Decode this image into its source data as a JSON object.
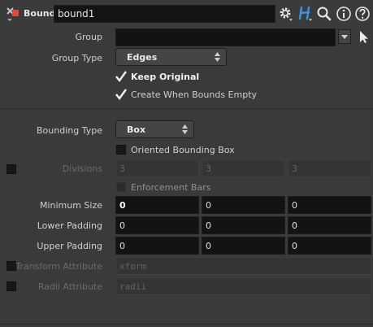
{
  "header": {
    "node_type": "Bound",
    "node_name": "bound1"
  },
  "group": {
    "label": "Group",
    "value": ""
  },
  "group_type": {
    "label": "Group Type",
    "value": "Edges"
  },
  "keep_original": {
    "label": "Keep Original",
    "checked": true
  },
  "create_when_empty": {
    "label": "Create When Bounds Empty",
    "checked": true
  },
  "bounding_type": {
    "label": "Bounding Type",
    "value": "Box"
  },
  "oriented_bbox": {
    "label": "Oriented Bounding Box",
    "checked": false
  },
  "divisions": {
    "label": "Divisions",
    "values": [
      "3",
      "3",
      "3"
    ]
  },
  "enforcement_bars": {
    "label": "Enforcement Bars",
    "checked": false
  },
  "minimum_size": {
    "label": "Minimum Size",
    "values": [
      "0",
      "0",
      "0"
    ]
  },
  "lower_padding": {
    "label": "Lower Padding",
    "values": [
      "0",
      "0",
      "0"
    ]
  },
  "upper_padding": {
    "label": "Upper Padding",
    "values": [
      "0",
      "0",
      "0"
    ]
  },
  "transform_attribute": {
    "label": "Transform Attribute",
    "value": "xform"
  },
  "radii_attribute": {
    "label": "Radii Attribute",
    "value": "radii"
  },
  "colors": {
    "background": "#3a3a3a",
    "field": "#131313",
    "help_icon_blue": "#2f78c9"
  },
  "icons": [
    "node-type-icon",
    "gear-icon",
    "houdini-h-icon",
    "search-icon",
    "info-icon",
    "help-icon",
    "group-select-arrow-icon",
    "cursor-arrow-icon",
    "checkmark-icon"
  ]
}
